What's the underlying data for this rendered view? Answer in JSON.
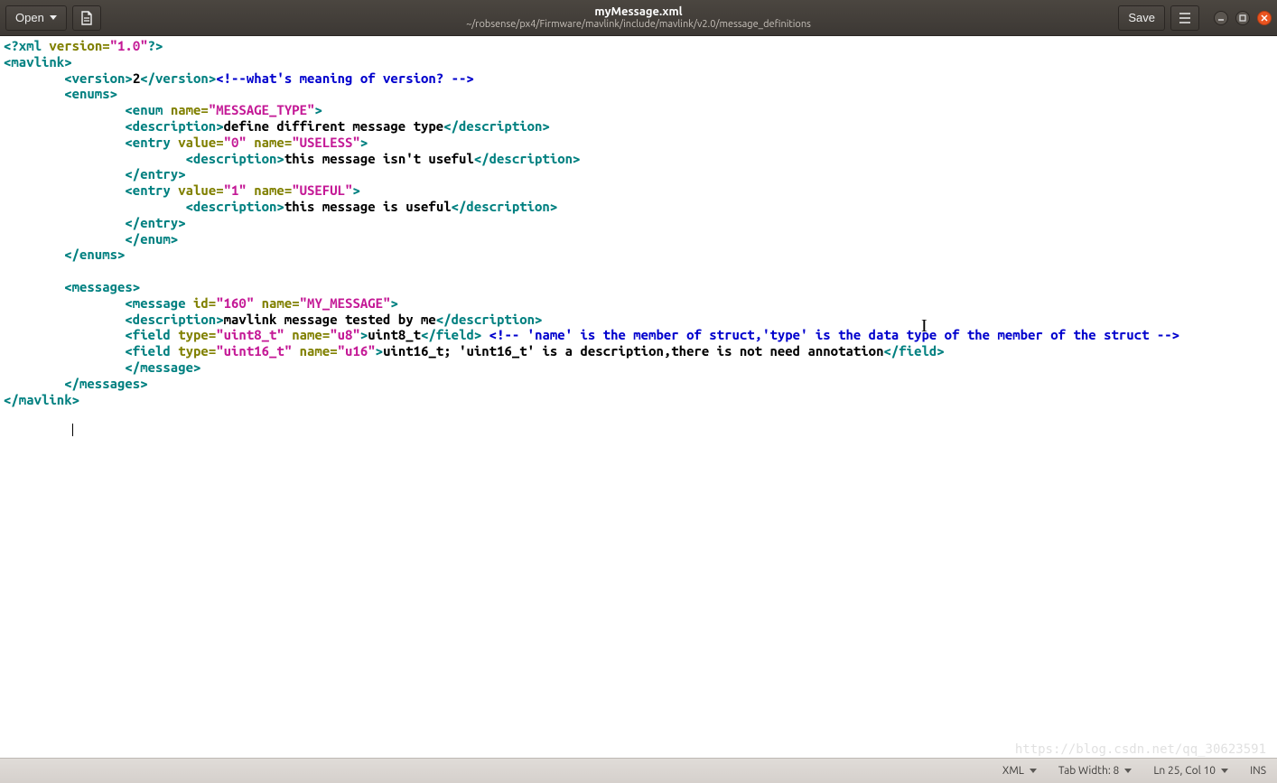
{
  "titlebar": {
    "open_label": "Open",
    "save_label": "Save",
    "file_title": "myMessage.xml",
    "file_path": "~/robsense/px4/Firmware/mavlink/include/mavlink/v2.0/message_definitions"
  },
  "code": {
    "lines": [
      {
        "depth": 0,
        "parts": [
          {
            "cls": "tok-tag",
            "t": "<?xml"
          },
          {
            "cls": "tok-attr",
            "t": " version="
          },
          {
            "cls": "tok-str",
            "t": "\"1.0\""
          },
          {
            "cls": "tok-tag",
            "t": "?>"
          }
        ]
      },
      {
        "depth": 0,
        "parts": [
          {
            "cls": "tok-tag",
            "t": "<mavlink>"
          }
        ]
      },
      {
        "depth": 2,
        "parts": [
          {
            "cls": "tok-tag",
            "t": "<version>"
          },
          {
            "cls": "tok-text",
            "t": "2"
          },
          {
            "cls": "tok-tag",
            "t": "</version>"
          },
          {
            "cls": "tok-comment",
            "t": "<!--what's meaning of version? -->"
          }
        ]
      },
      {
        "depth": 2,
        "parts": [
          {
            "cls": "tok-tag",
            "t": "<enums>"
          }
        ]
      },
      {
        "depth": 4,
        "parts": [
          {
            "cls": "tok-tag",
            "t": "<enum"
          },
          {
            "cls": "tok-attr",
            "t": " name="
          },
          {
            "cls": "tok-str",
            "t": "\"MESSAGE_TYPE\""
          },
          {
            "cls": "tok-tag",
            "t": ">"
          }
        ]
      },
      {
        "depth": 4,
        "parts": [
          {
            "cls": "tok-tag",
            "t": "<description>"
          },
          {
            "cls": "tok-text",
            "t": "define diffirent message type"
          },
          {
            "cls": "tok-tag",
            "t": "</description>"
          }
        ]
      },
      {
        "depth": 4,
        "parts": [
          {
            "cls": "tok-tag",
            "t": "<entry"
          },
          {
            "cls": "tok-attr",
            "t": " value="
          },
          {
            "cls": "tok-str",
            "t": "\"0\""
          },
          {
            "cls": "tok-attr",
            "t": " name="
          },
          {
            "cls": "tok-str",
            "t": "\"USELESS\""
          },
          {
            "cls": "tok-tag",
            "t": ">"
          }
        ]
      },
      {
        "depth": 6,
        "parts": [
          {
            "cls": "tok-tag",
            "t": "<description>"
          },
          {
            "cls": "tok-text",
            "t": "this message isn't useful"
          },
          {
            "cls": "tok-tag",
            "t": "</description>"
          }
        ]
      },
      {
        "depth": 4,
        "parts": [
          {
            "cls": "tok-tag",
            "t": "</entry>"
          }
        ]
      },
      {
        "depth": 4,
        "parts": [
          {
            "cls": "tok-tag",
            "t": "<entry"
          },
          {
            "cls": "tok-attr",
            "t": " value="
          },
          {
            "cls": "tok-str",
            "t": "\"1\""
          },
          {
            "cls": "tok-attr",
            "t": " name="
          },
          {
            "cls": "tok-str",
            "t": "\"USEFUL\""
          },
          {
            "cls": "tok-tag",
            "t": ">"
          }
        ]
      },
      {
        "depth": 6,
        "parts": [
          {
            "cls": "tok-tag",
            "t": "<description>"
          },
          {
            "cls": "tok-text",
            "t": "this message is useful"
          },
          {
            "cls": "tok-tag",
            "t": "</description>"
          }
        ]
      },
      {
        "depth": 4,
        "parts": [
          {
            "cls": "tok-tag",
            "t": "</entry>"
          }
        ]
      },
      {
        "depth": 4,
        "parts": [
          {
            "cls": "tok-tag",
            "t": "</enum>"
          }
        ]
      },
      {
        "depth": 2,
        "parts": [
          {
            "cls": "tok-tag",
            "t": "</enums>"
          }
        ]
      },
      {
        "depth": 0,
        "parts": []
      },
      {
        "depth": 2,
        "parts": [
          {
            "cls": "tok-tag",
            "t": "<messages>"
          }
        ]
      },
      {
        "depth": 4,
        "parts": [
          {
            "cls": "tok-tag",
            "t": "<message"
          },
          {
            "cls": "tok-attr",
            "t": " id="
          },
          {
            "cls": "tok-str",
            "t": "\"160\""
          },
          {
            "cls": "tok-attr",
            "t": " name="
          },
          {
            "cls": "tok-str",
            "t": "\"MY_MESSAGE\""
          },
          {
            "cls": "tok-tag",
            "t": ">"
          }
        ]
      },
      {
        "depth": 4,
        "parts": [
          {
            "cls": "tok-tag",
            "t": "<description>"
          },
          {
            "cls": "tok-text",
            "t": "mavlink message tested by me"
          },
          {
            "cls": "tok-tag",
            "t": "</description>"
          }
        ]
      },
      {
        "depth": 4,
        "parts": [
          {
            "cls": "tok-tag",
            "t": "<field"
          },
          {
            "cls": "tok-attr",
            "t": " type="
          },
          {
            "cls": "tok-str",
            "t": "\"uint8_t\""
          },
          {
            "cls": "tok-attr",
            "t": " name="
          },
          {
            "cls": "tok-str",
            "t": "\"u8\""
          },
          {
            "cls": "tok-tag",
            "t": ">"
          },
          {
            "cls": "tok-text",
            "t": "uint8_t"
          },
          {
            "cls": "tok-tag",
            "t": "</field>"
          },
          {
            "cls": "tok-text",
            "t": " "
          },
          {
            "cls": "tok-comment",
            "t": "<!-- 'name' is the member of struct,'type' is the data type of the member of the struct -->"
          }
        ]
      },
      {
        "depth": 4,
        "parts": [
          {
            "cls": "tok-tag",
            "t": "<field"
          },
          {
            "cls": "tok-attr",
            "t": " type="
          },
          {
            "cls": "tok-str",
            "t": "\"uint16_t\""
          },
          {
            "cls": "tok-attr",
            "t": " name="
          },
          {
            "cls": "tok-str",
            "t": "\"u16\""
          },
          {
            "cls": "tok-tag",
            "t": ">"
          },
          {
            "cls": "tok-text",
            "t": "uint16_t; 'uint16_t' is a description,there is not need annotation"
          },
          {
            "cls": "tok-tag",
            "t": "</field>"
          }
        ]
      },
      {
        "depth": 4,
        "parts": [
          {
            "cls": "tok-tag",
            "t": "</message>"
          }
        ]
      },
      {
        "depth": 2,
        "parts": [
          {
            "cls": "tok-tag",
            "t": "</messages>"
          }
        ]
      },
      {
        "depth": 0,
        "parts": [
          {
            "cls": "tok-tag",
            "t": "</mavlink>"
          }
        ]
      }
    ],
    "caret_indent": "         "
  },
  "statusbar": {
    "lang": "XML",
    "tab_width": "Tab Width: 8",
    "position": "Ln 25, Col 10",
    "insert_mode": "INS",
    "watermark": "https://blog.csdn.net/qq_30623591"
  }
}
